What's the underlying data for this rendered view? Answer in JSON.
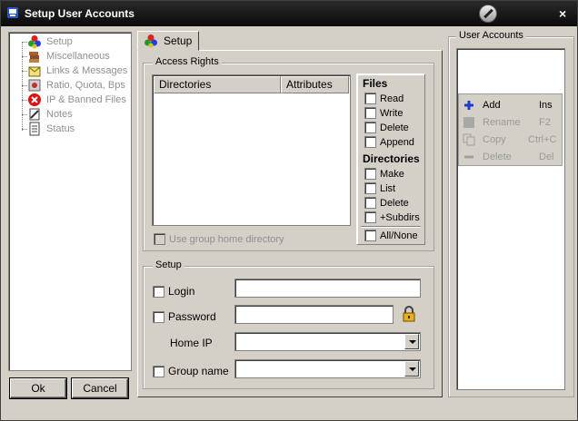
{
  "window": {
    "title": "Setup User Accounts",
    "close_glyph": "×"
  },
  "tree": {
    "items": [
      {
        "label": "Setup",
        "icon": "setup-icon"
      },
      {
        "label": "Miscellaneous",
        "icon": "books-icon"
      },
      {
        "label": "Links & Messages",
        "icon": "links-icon"
      },
      {
        "label": "Ratio, Quota, Bps",
        "icon": "ratio-icon"
      },
      {
        "label": "IP & Banned Files",
        "icon": "banned-icon"
      },
      {
        "label": "Notes",
        "icon": "notes-icon"
      },
      {
        "label": "Status",
        "icon": "status-icon"
      }
    ]
  },
  "buttons": {
    "ok": "Ok",
    "cancel": "Cancel"
  },
  "tab": {
    "label": "Setup"
  },
  "access_rights": {
    "legend": "Access Rights",
    "columns": [
      "Directories",
      "Attributes"
    ],
    "use_group_home": "Use group home directory",
    "files_heading": "Files",
    "files": [
      "Read",
      "Write",
      "Delete",
      "Append"
    ],
    "dirs_heading": "Directories",
    "dirs": [
      "Make",
      "List",
      "Delete",
      "+Subdirs"
    ],
    "all_none": "All/None"
  },
  "setup": {
    "legend": "Setup",
    "login_label": "Login",
    "login_value": "",
    "password_label": "Password",
    "password_value": "",
    "home_ip_label": "Home IP",
    "home_ip_value": "",
    "group_name_label": "Group name",
    "group_name_value": ""
  },
  "user_accounts": {
    "legend": "User Accounts",
    "menu": [
      {
        "label": "Add",
        "shortcut": "Ins",
        "enabled": true,
        "icon": "plus-icon"
      },
      {
        "label": "Rename",
        "shortcut": "F2",
        "enabled": false,
        "icon": "rename-icon"
      },
      {
        "label": "Copy",
        "shortcut": "Ctrl+C",
        "enabled": false,
        "icon": "copy-icon"
      },
      {
        "label": "Delete",
        "shortcut": "Del",
        "enabled": false,
        "icon": "minus-icon"
      }
    ]
  },
  "colors": {
    "titlebar": "#111111",
    "face": "#d4d0c8",
    "accent_blue": "#1a3fc8"
  }
}
